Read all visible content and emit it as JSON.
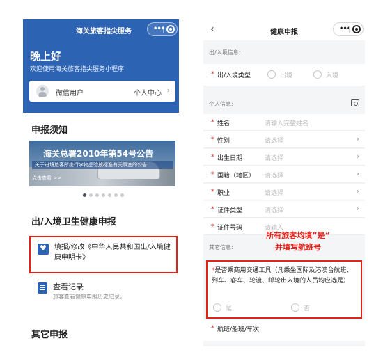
{
  "left": {
    "title": "海关旅客指尖服务",
    "greeting": "晚上好",
    "welcome": "欢迎使用海关旅客指尖服务小程序",
    "user": {
      "name": "微信用户",
      "center": "个人中心"
    },
    "notice_title": "申报须知",
    "banner": {
      "title": "海关总署2010年第54号公告",
      "subtitle": "关于进境旅客所携行李物品验放标准有关事宜的公告",
      "link": "点击查看 >>"
    },
    "slides": {
      "count": 7,
      "active": 0
    },
    "health_title": "出/入境卫生健康申报",
    "declare_card": {
      "label": "填报/修改《中华人民共和国出/入境健康申明卡》"
    },
    "record": {
      "title": "查看记录",
      "subtitle": "旅客查看健康申报历史记录。"
    },
    "other_title": "其它申报",
    "colors": {
      "header": "#2d63b3",
      "highlight_border": "#e2231a"
    }
  },
  "right": {
    "title": "健康申报",
    "exit_entry_group": "出/入境信息:",
    "type_label": "出/入境类型",
    "type_options": [
      "出境",
      "入境"
    ],
    "personal_group": "个人信息:",
    "fields": [
      {
        "label": "姓名",
        "placeholder": "请输入完整姓名",
        "chevron": false
      },
      {
        "label": "性别",
        "placeholder": "请选择",
        "chevron": true
      },
      {
        "label": "出生日期",
        "placeholder": "请选择",
        "chevron": true
      },
      {
        "label": "国籍（地区）",
        "placeholder": "请选择",
        "chevron": true
      },
      {
        "label": "职业",
        "placeholder": "请选择",
        "chevron": true
      },
      {
        "label": "证件类型",
        "placeholder": "请选择",
        "chevron": true
      },
      {
        "label": "证件号码",
        "placeholder": "请输入",
        "chevron": false
      }
    ],
    "other_group": "其它信息:",
    "hint_line1": "所有旅客均填”是“",
    "hint_line2": "并填写航班号",
    "question": "是否乘商用交通工具（凡乘坐国际及港澳台航班、列车、客车、轮渡、邮轮出入境的人员均应选是）",
    "answers": [
      "是",
      "否"
    ],
    "flight_label": "航班/船班/车次",
    "colors": {
      "required": "#e2231a",
      "placeholder": "#bdbdbd"
    }
  }
}
